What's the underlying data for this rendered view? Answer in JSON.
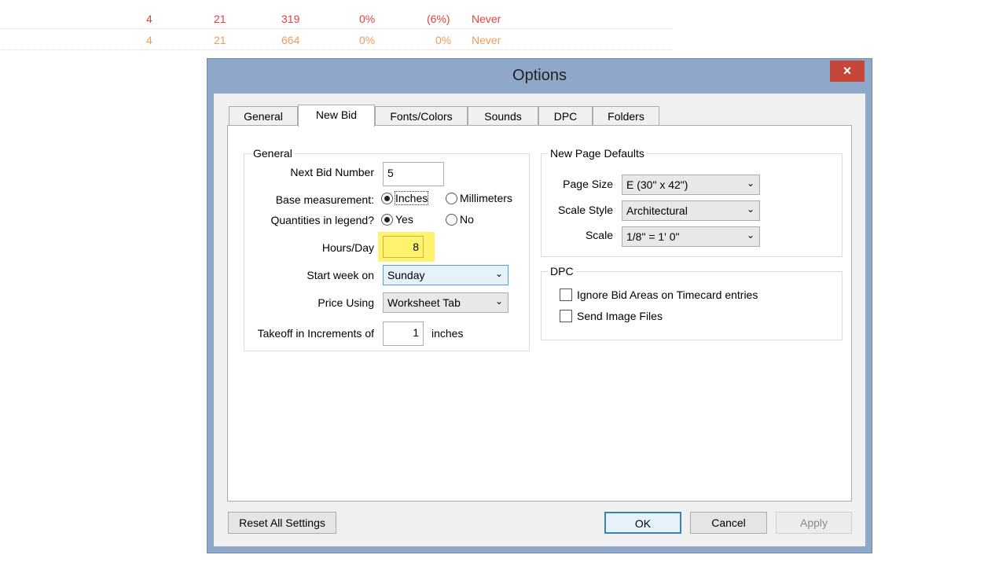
{
  "background_table": {
    "rows": [
      {
        "cols": [
          "4",
          "21",
          "319",
          "0%",
          "(6%)",
          "Never"
        ],
        "color": "#e8403a"
      },
      {
        "cols": [
          "4",
          "21",
          "664",
          "0%",
          "0%",
          "Never"
        ],
        "color": "#f39a5a"
      }
    ]
  },
  "dialog": {
    "title": "Options",
    "close_icon": "×",
    "tabs": [
      "General",
      "New Bid",
      "Fonts/Colors",
      "Sounds",
      "DPC",
      "Folders"
    ],
    "general_group": {
      "label": "General",
      "next_bid_label": "Next Bid Number",
      "next_bid_value": "5",
      "base_label": "Base measurement:",
      "inches": "Inches",
      "millimeters": "Millimeters",
      "qty_label": "Quantities in legend?",
      "yes": "Yes",
      "no": "No",
      "hours_label": "Hours/Day",
      "hours_value": "8",
      "start_label": "Start week on",
      "start_value": "Sunday",
      "price_label": "Price Using",
      "price_value": "Worksheet Tab",
      "takeoff_label": "Takeoff in Increments of",
      "takeoff_value": "1",
      "takeoff_unit": "inches"
    },
    "page_defaults": {
      "label": "New Page Defaults",
      "size_label": "Page Size",
      "size_value": "E (30\" x 42\")",
      "style_label": "Scale Style",
      "style_value": "Architectural",
      "scale_label": "Scale",
      "scale_value": "1/8\" = 1' 0\""
    },
    "dpc": {
      "label": "DPC",
      "ignore": "Ignore Bid Areas on Timecard entries",
      "send": "Send Image Files"
    },
    "buttons": {
      "reset": "Reset All Settings",
      "ok": "OK",
      "cancel": "Cancel",
      "apply": "Apply"
    }
  }
}
